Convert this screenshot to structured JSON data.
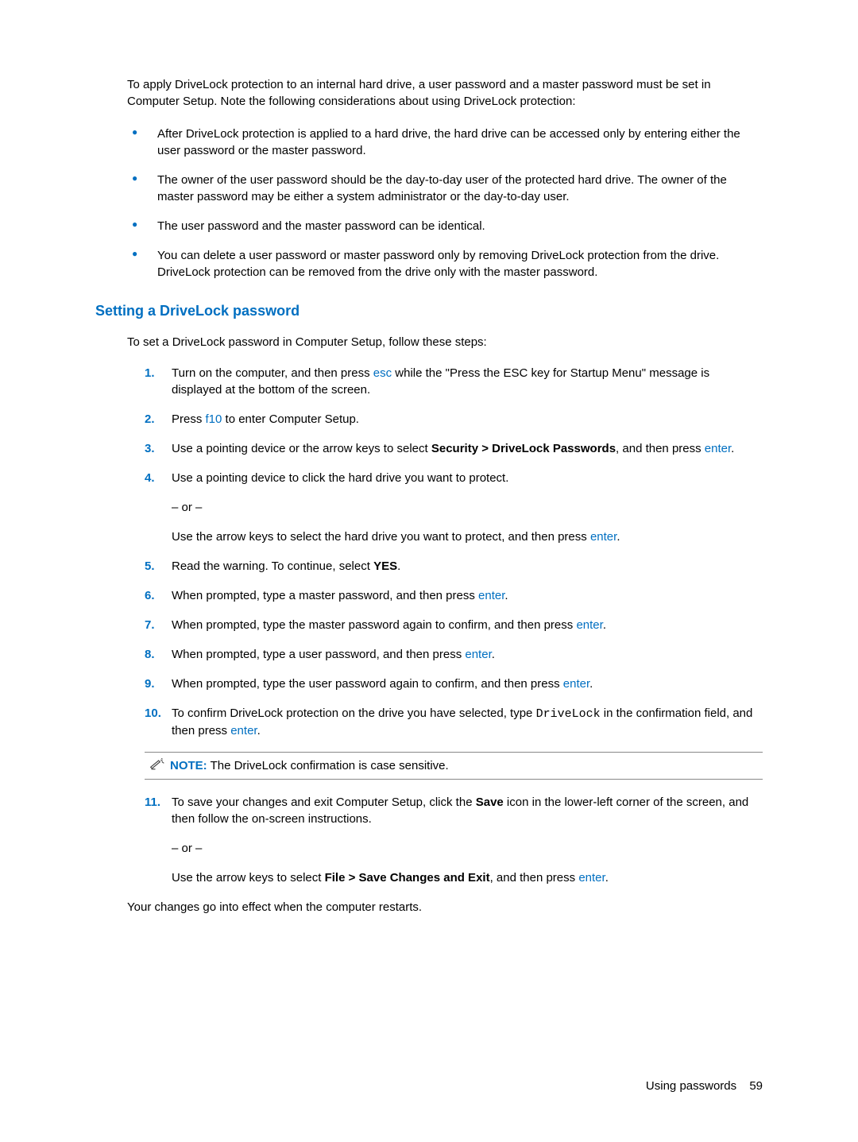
{
  "intro": "To apply DriveLock protection to an internal hard drive, a user password and a master password must be set in Computer Setup. Note the following considerations about using DriveLock protection:",
  "bullets": [
    "After DriveLock protection is applied to a hard drive, the hard drive can be accessed only by entering either the user password or the master password.",
    "The owner of the user password should be the day-to-day user of the protected hard drive. The owner of the master password may be either a system administrator or the day-to-day user.",
    "The user password and the master password can be identical.",
    "You can delete a user password or master password only by removing DriveLock protection from the drive. DriveLock protection can be removed from the drive only with the master password."
  ],
  "heading": "Setting a DriveLock password",
  "section_intro": "To set a DriveLock password in Computer Setup, follow these steps:",
  "steps": {
    "s1_a": "Turn on the computer, and then press ",
    "s1_key": "esc",
    "s1_b": " while the \"Press the ESC key for Startup Menu\" message is displayed at the bottom of the screen.",
    "s2_a": "Press ",
    "s2_key": "f10",
    "s2_b": " to enter Computer Setup.",
    "s3_a": "Use a pointing device or the arrow keys to select ",
    "s3_bold": "Security > DriveLock Passwords",
    "s3_b": ", and then press ",
    "s3_key": "enter",
    "s3_c": ".",
    "s4_a": "Use a pointing device to click the hard drive you want to protect.",
    "s4_or": "– or –",
    "s4_b": "Use the arrow keys to select the hard drive you want to protect, and then press ",
    "s4_key": "enter",
    "s4_c": ".",
    "s5_a": "Read the warning. To continue, select ",
    "s5_bold": "YES",
    "s5_b": ".",
    "s6_a": "When prompted, type a master password, and then press ",
    "s6_key": "enter",
    "s6_b": ".",
    "s7_a": "When prompted, type the master password again to confirm, and then press ",
    "s7_key": "enter",
    "s7_b": ".",
    "s8_a": "When prompted, type a user password, and then press ",
    "s8_key": "enter",
    "s8_b": ".",
    "s9_a": "When prompted, type the user password again to confirm, and then press ",
    "s9_key": "enter",
    "s9_b": ".",
    "s10_a": "To confirm DriveLock protection on the drive you have selected, type ",
    "s10_mono": "DriveLock",
    "s10_b": " in the confirmation field, and then press ",
    "s10_key": "enter",
    "s10_c": ".",
    "s11_a": "To save your changes and exit Computer Setup, click the ",
    "s11_bold1": "Save",
    "s11_b": " icon in the lower-left corner of the screen, and then follow the on-screen instructions.",
    "s11_or": "– or –",
    "s11_c": "Use the arrow keys to select ",
    "s11_bold2": "File > Save Changes and Exit",
    "s11_d": ", and then press ",
    "s11_key": "enter",
    "s11_e": "."
  },
  "note_label": "NOTE:",
  "note_text": "The DriveLock confirmation is case sensitive.",
  "closing": "Your changes go into effect when the computer restarts.",
  "footer_text": "Using passwords",
  "footer_page": "59"
}
